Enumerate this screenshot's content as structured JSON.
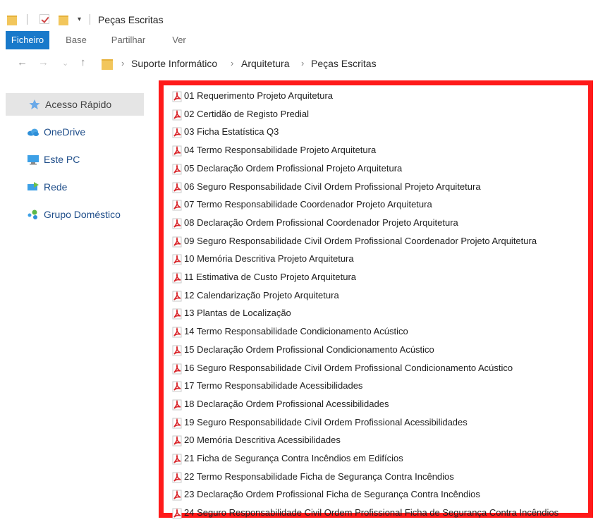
{
  "window": {
    "title": "Peças Escritas"
  },
  "ribbon": {
    "tabs": [
      {
        "label": "Ficheiro",
        "active": true
      },
      {
        "label": "Base"
      },
      {
        "label": "Partilhar"
      },
      {
        "label": "Ver"
      }
    ]
  },
  "address": {
    "breadcrumbs": [
      "Suporte Informático",
      "Arquitetura",
      "Peças Escritas"
    ]
  },
  "sidebar": {
    "items": [
      {
        "label": "Acesso Rápido",
        "icon": "star-icon"
      },
      {
        "label": "OneDrive",
        "icon": "cloud-icon"
      },
      {
        "label": "Este PC",
        "icon": "computer-icon"
      },
      {
        "label": "Rede",
        "icon": "network-icon"
      },
      {
        "label": "Grupo Doméstico",
        "icon": "homegroup-icon"
      }
    ]
  },
  "files": [
    "01 Requerimento Projeto Arquitetura",
    "02 Certidão de Registo Predial",
    "03 Ficha Estatística Q3",
    "04 Termo Responsabilidade Projeto Arquitetura",
    "05 Declaração Ordem Profissional Projeto Arquitetura",
    "06 Seguro Responsabilidade Civil Ordem Profissional Projeto Arquitetura",
    "07 Termo Responsabilidade Coordenador Projeto Arquitetura",
    "08 Declaração Ordem Profissional Coordenador Projeto Arquitetura",
    "09 Seguro Responsabilidade Civil Ordem Profissional Coordenador Projeto Arquitetura",
    "10 Memória Descritiva Projeto Arquitetura",
    "11 Estimativa de Custo Projeto Arquitetura",
    "12 Calendarização Projeto Arquitetura",
    "13 Plantas de Localização",
    "14 Termo Responsabilidade Condicionamento Acústico",
    "15 Declaração Ordem Profissional Condicionamento Acústico",
    "16 Seguro Responsabilidade Civil Ordem Profissional Condicionamento Acústico",
    "17 Termo Responsabilidade Acessibilidades",
    "18 Declaração Ordem Profissional Acessibilidades",
    "19 Seguro Responsabilidade Civil Ordem Profissional Acessibilidades",
    "20 Memória Descritiva Acessibilidades",
    "21 Ficha de Segurança Contra Incêndios em Edifícios",
    "22 Termo Responsabilidade Ficha de Segurança Contra Incêndios",
    "23 Declaração Ordem Profissional Ficha de Segurança Contra Incêndios",
    "24 Seguro Responsabilidade Civil Ordem Profissional Ficha de Segurança Contra Incêndios"
  ],
  "colors": {
    "accent": "#1979ca",
    "highlight_border": "#ff1a1a",
    "pdf_red": "#d9262b",
    "folder": "#f2c65c"
  }
}
